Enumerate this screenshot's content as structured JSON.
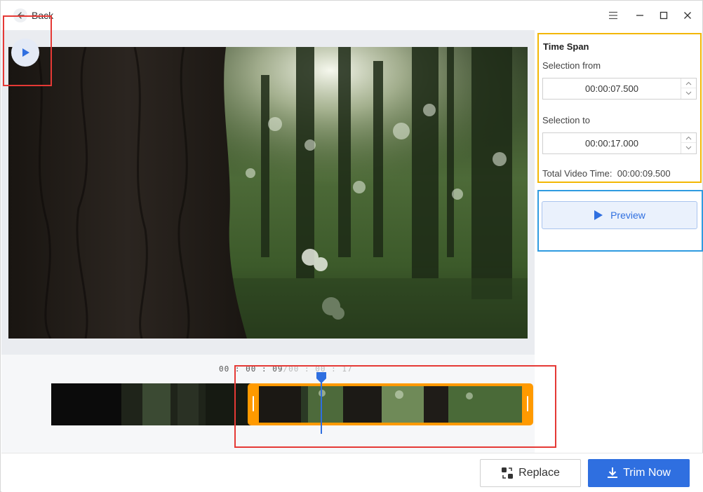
{
  "titlebar": {
    "back_label": "Back",
    "icons": [
      "arrow-left-icon",
      "menu-icon",
      "minimize-icon",
      "maximize-icon",
      "close-icon"
    ]
  },
  "player": {
    "timecode_current": "00 : 00 : 09",
    "timecode_separator": "/",
    "timecode_end": "00 : 00 : 17",
    "play_icon": "play-icon"
  },
  "time_span": {
    "title": "Time Span",
    "selection_from_label": "Selection from",
    "selection_from_value": "00:00:07.500",
    "selection_to_label": "Selection to",
    "selection_to_value": "00:00:17.000",
    "total_label": "Total Video Time:",
    "total_value": "00:00:09.500"
  },
  "preview": {
    "label": "Preview",
    "icon": "play-icon"
  },
  "footer": {
    "replace_label": "Replace",
    "replace_icon": "replace-icon",
    "trim_label": "Trim Now",
    "trim_icon": "download-icon"
  },
  "colors": {
    "accent": "#2f6fe0",
    "selection": "#ff9a00",
    "highlight_red": "#e53935",
    "highlight_yellow": "#f2b705",
    "highlight_blue": "#2f9be0"
  }
}
